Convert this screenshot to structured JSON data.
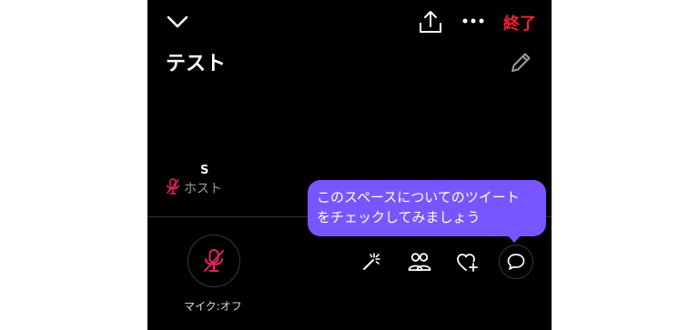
{
  "colors": {
    "background": "#000000",
    "text": "#ffffff",
    "muted": "#9a9a9a",
    "accent_red": "#f4212e",
    "muted_pink": "#e0245e",
    "tooltip": "#7856ff"
  },
  "header": {
    "collapse_icon": "chevron-down-icon",
    "share_icon": "share-icon",
    "more_icon": "more-icon",
    "end_label": "終了"
  },
  "space": {
    "title": "テスト",
    "edit_icon": "pencil-icon"
  },
  "speaker": {
    "name": "S",
    "role": "ホスト",
    "muted_icon": "mic-off-icon"
  },
  "bottom_bar": {
    "mic_label": "マイク:オフ",
    "effects_icon": "magic-wand-icon",
    "people_icon": "people-icon",
    "react_icon": "heart-plus-icon",
    "comment_icon": "comment-icon"
  },
  "tooltip": {
    "line1": "このスペースについてのツイート",
    "line2": "をチェックしてみましょう"
  }
}
